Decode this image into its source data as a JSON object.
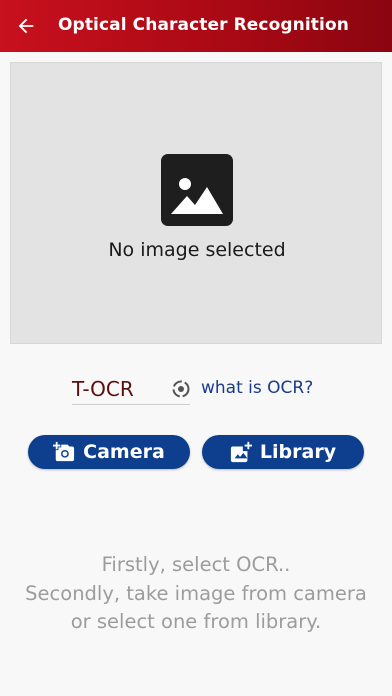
{
  "header": {
    "title": "Optical Character Recognition",
    "back_icon": "arrow-left-icon",
    "background": "#b00b16"
  },
  "image_panel": {
    "placeholder_icon": "image-icon",
    "message": "No image selected"
  },
  "ocr": {
    "selected_value": "T-OCR",
    "help_icon": "info-icon",
    "help_link": "what is OCR?"
  },
  "actions": {
    "camera": {
      "label": "Camera",
      "icon": "add-camera-icon"
    },
    "library": {
      "label": "Library",
      "icon": "add-photo-icon"
    },
    "button_color": "#0d3f8e"
  },
  "instructions": {
    "lines": [
      "Firstly, select OCR..",
      "Secondly, take image from camera",
      "or select one from library."
    ]
  }
}
